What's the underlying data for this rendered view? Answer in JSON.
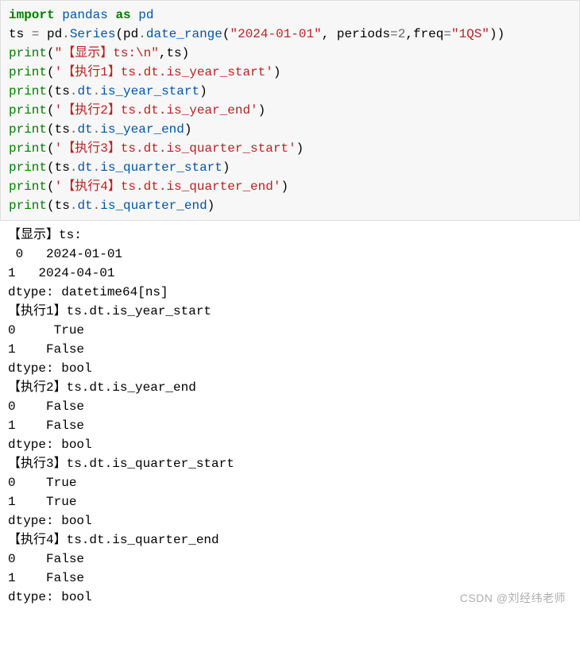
{
  "code": {
    "l1": {
      "kw_import": "import",
      "mod": "pandas",
      "kw_as": "as",
      "alias": "pd"
    },
    "l2": {
      "var": "ts",
      "eq": " = ",
      "pd": "pd",
      "series": "Series",
      "date_range": "date_range",
      "arg1": "\"2024-01-01\"",
      "periods_k": "periods",
      "periods_v": "2",
      "freq_k": "freq",
      "freq_v": "\"1QS\""
    },
    "l3": {
      "print": "print",
      "arg1": "\"【显示】ts:\\n\"",
      "comma": ",",
      "arg2": "ts"
    },
    "l4": {
      "print": "print",
      "arg": "'【执行1】ts.dt.is_year_start'"
    },
    "l5": {
      "print": "print",
      "obj": "ts",
      "dt": "dt",
      "prop": "is_year_start"
    },
    "l6": {
      "print": "print",
      "arg": "'【执行2】ts.dt.is_year_end'"
    },
    "l7": {
      "print": "print",
      "obj": "ts",
      "dt": "dt",
      "prop": "is_year_end"
    },
    "l8": {
      "print": "print",
      "arg": "'【执行3】ts.dt.is_quarter_start'"
    },
    "l9": {
      "print": "print",
      "obj": "ts",
      "dt": "dt",
      "prop": "is_quarter_start"
    },
    "l10": {
      "print": "print",
      "arg": "'【执行4】ts.dt.is_quarter_end'"
    },
    "l11": {
      "print": "print",
      "obj": "ts",
      "dt": "dt",
      "prop": "is_quarter_end"
    }
  },
  "output": {
    "show_header": "【显示】ts:",
    "ts_row0": " 0   2024-01-01",
    "ts_row1": "1   2024-04-01",
    "ts_dtype": "dtype: datetime64[ns]",
    "ex1_header": "【执行1】ts.dt.is_year_start",
    "ex1_row0": "0     True",
    "ex1_row1": "1    False",
    "ex1_dtype": "dtype: bool",
    "ex2_header": "【执行2】ts.dt.is_year_end",
    "ex2_row0": "0    False",
    "ex2_row1": "1    False",
    "ex2_dtype": "dtype: bool",
    "ex3_header": "【执行3】ts.dt.is_quarter_start",
    "ex3_row0": "0    True",
    "ex3_row1": "1    True",
    "ex3_dtype": "dtype: bool",
    "ex4_header": "【执行4】ts.dt.is_quarter_end",
    "ex4_row0": "0    False",
    "ex4_row1": "1    False",
    "ex4_dtype": "dtype: bool"
  },
  "watermark": "CSDN @刘经纬老师"
}
